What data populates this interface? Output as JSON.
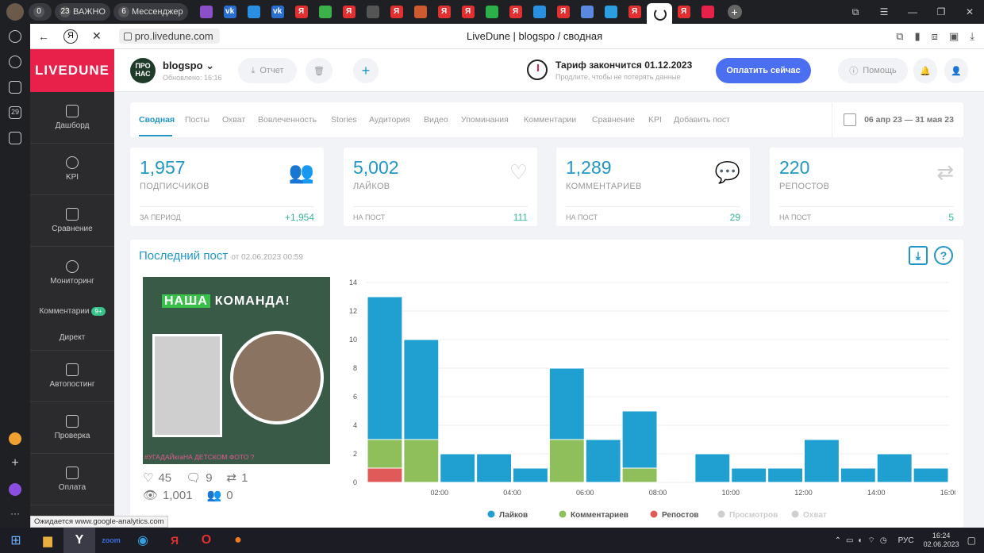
{
  "browser": {
    "tabs_left": [
      {
        "num": "0",
        "label": ""
      },
      {
        "num": "23",
        "label": "ВАЖНО"
      },
      {
        "num": "6",
        "label": "Мессенджер"
      }
    ],
    "url": "pro.livedune.com",
    "page_title": "LiveDune | blogspo / сводная",
    "status_text": "Ожидается www.google-analytics.com"
  },
  "colors": {
    "brand": "#e8214a",
    "accent": "#2196c8",
    "pay": "#4b6ff1",
    "likes": "#1fa0d0",
    "comments": "#8fbf5a",
    "reposts": "#e05a5a",
    "disabled": "#cfcfcf"
  },
  "sidebar": {
    "logo": "LIVEDUNE",
    "items": [
      {
        "label": "Дашборд",
        "icon": "dashboard-icon"
      },
      {
        "label": "KPI",
        "icon": "target-icon"
      },
      {
        "label": "Сравнение",
        "icon": "scales-icon"
      },
      {
        "label": "Мониторинг",
        "icon": "chat-bubble-icon"
      }
    ],
    "sub_items": [
      {
        "label": "Комментарии",
        "badge": "9+"
      },
      {
        "label": "Директ"
      }
    ],
    "items2": [
      {
        "label": "Автопостинг",
        "icon": "calendar-plus-icon"
      },
      {
        "label": "Проверка",
        "icon": "shield-check-icon"
      },
      {
        "label": "Оплата",
        "icon": "basket-icon"
      }
    ]
  },
  "header": {
    "avatar_text": "ПРО НАС",
    "account": "blogspo",
    "updated": "Обновлено: 16:16",
    "report_label": "Отчет",
    "tariff": "Тариф закончится 01.12.2023",
    "tariff_sub": "Продлите, чтобы не потерять данные",
    "pay_label": "Оплатить сейчас",
    "help_label": "Помощь"
  },
  "tabs": [
    "Сводная",
    "Посты",
    "Охват",
    "Вовлеченность",
    "Stories",
    "Аудитория",
    "Видео",
    "Упоминания",
    "Комментарии",
    "Сравнение",
    "KPI",
    "Добавить пост"
  ],
  "date_range": "06 апр 23 — 31 мая 23",
  "cards": [
    {
      "value": "1,957",
      "label": "ПОДПИСЧИКОВ",
      "sub": "ЗА ПЕРИОД",
      "delta": "+1,954",
      "icon": "users-icon"
    },
    {
      "value": "5,002",
      "label": "ЛАЙКОВ",
      "sub": "НА ПОСТ",
      "delta": "111",
      "icon": "heart-icon"
    },
    {
      "value": "1,289",
      "label": "КОММЕНТАРИЕВ",
      "sub": "НА ПОСТ",
      "delta": "29",
      "icon": "comments-icon"
    },
    {
      "value": "220",
      "label": "РЕПОСТОВ",
      "sub": "НА ПОСТ",
      "delta": "5",
      "icon": "repost-icon"
    }
  ],
  "last_post": {
    "title": "Последний пост",
    "date": "от 02.06.2023 00:59",
    "image_heading_1": "НАША",
    "image_heading_2": "КОМАНДА!",
    "image_tagline": "#УГАДАЙкгаНА ДЕТСКОМ ФОТО ?",
    "likes": "45",
    "comments": "9",
    "reposts": "1",
    "views": "1,001",
    "reach": "0"
  },
  "chart_data": {
    "type": "bar",
    "stacked": true,
    "x": [
      1,
      2,
      3,
      4,
      5,
      6,
      7,
      8,
      9,
      10,
      11,
      12,
      13,
      14,
      15,
      16
    ],
    "x_tick_labels": [
      "02:00",
      "04:00",
      "06:00",
      "08:00",
      "10:00",
      "12:00",
      "14:00",
      "16:00"
    ],
    "ylim": [
      0,
      14
    ],
    "y_ticks": [
      0,
      2,
      4,
      6,
      8,
      10,
      12,
      14
    ],
    "series": [
      {
        "name": "Лайков",
        "values": [
          10,
          7,
          2,
          2,
          1,
          5,
          3,
          4,
          0,
          2,
          1,
          1,
          3,
          1,
          2,
          1
        ]
      },
      {
        "name": "Комментариев",
        "values": [
          2,
          3,
          0,
          0,
          0,
          3,
          0,
          1,
          0,
          0,
          0,
          0,
          0,
          0,
          0,
          0
        ]
      },
      {
        "name": "Репостов",
        "values": [
          1,
          0,
          0,
          0,
          0,
          0,
          0,
          0,
          0,
          0,
          0,
          0,
          0,
          0,
          0,
          0
        ]
      }
    ],
    "legend": [
      "Лайков",
      "Комментариев",
      "Репостов",
      "Просмотров",
      "Охват"
    ],
    "legend_position": "bottom",
    "grid": true
  },
  "taskbar": {
    "lang": "РУС",
    "time": "16:24",
    "date": "02.06.2023"
  }
}
